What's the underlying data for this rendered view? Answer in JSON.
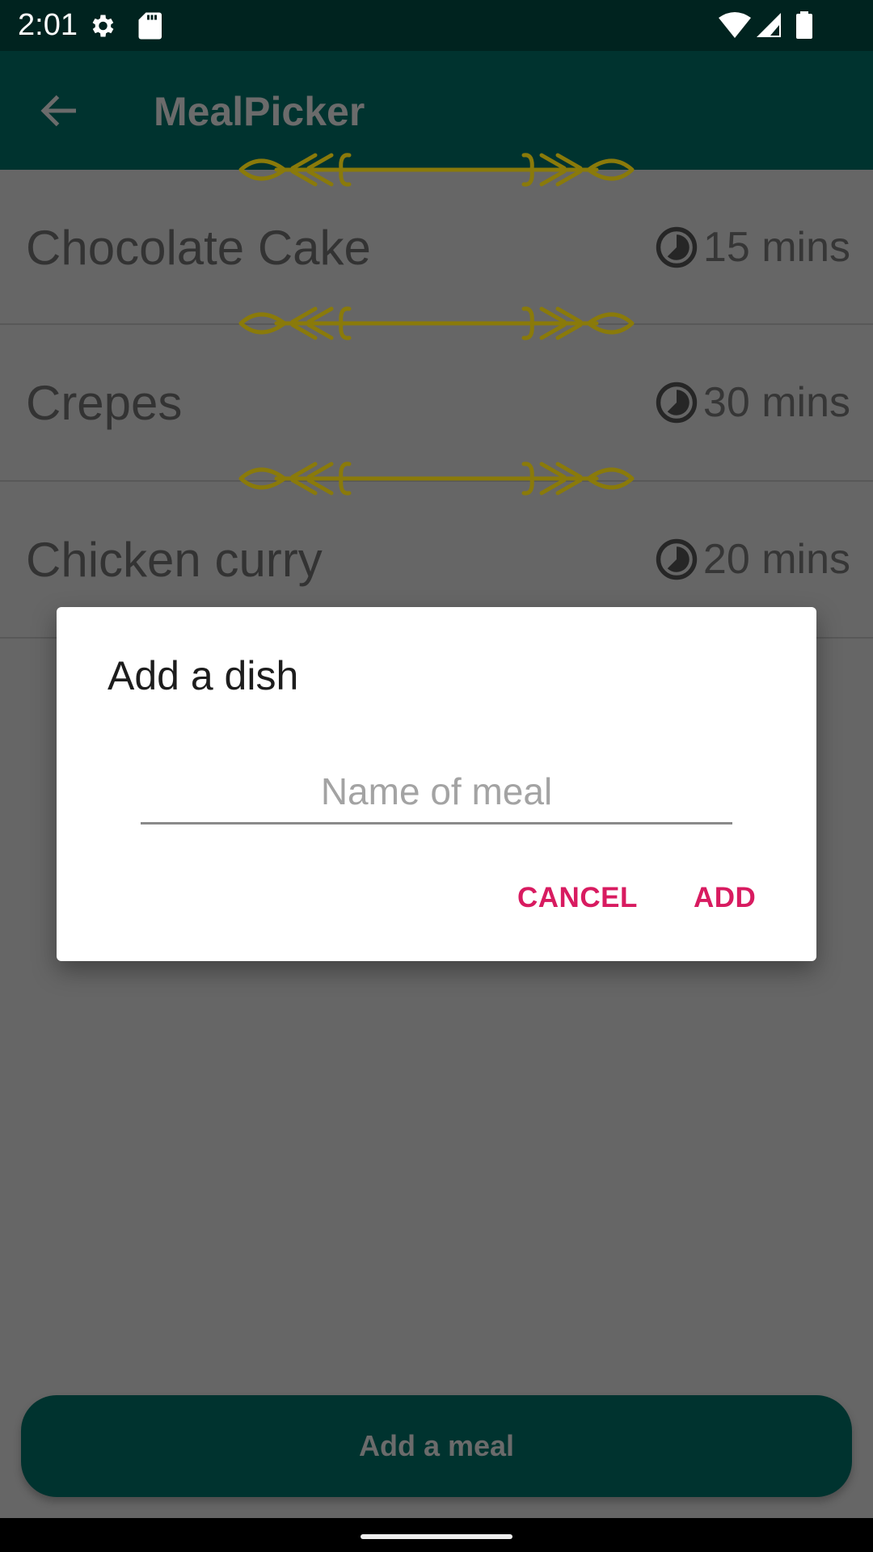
{
  "status_bar": {
    "time": "2:01",
    "left_icons": [
      "gear-icon",
      "sd-card-icon"
    ],
    "right_icons": [
      "wifi-icon",
      "cell-signal-icon",
      "battery-icon"
    ]
  },
  "app_bar": {
    "title": "MealPicker",
    "back_icon": "arrow-left-icon"
  },
  "meals": [
    {
      "name": "Chocolate Cake",
      "time": "15 mins",
      "icon": "timer-icon"
    },
    {
      "name": "Crepes",
      "time": "30 mins",
      "icon": "timer-icon"
    },
    {
      "name": "Chicken curry",
      "time": "20 mins",
      "icon": "timer-icon"
    }
  ],
  "dialog": {
    "title": "Add a dish",
    "input_placeholder": "Name of meal",
    "input_value": "",
    "cancel_label": "CANCEL",
    "add_label": "ADD"
  },
  "bottom_button": {
    "label": "Add a meal"
  },
  "colors": {
    "app_bar": "#00332f",
    "status_bar": "#00231f",
    "accent": "#d81b60",
    "ornament": "#8a7a0a",
    "scrim_background": "#666666"
  }
}
